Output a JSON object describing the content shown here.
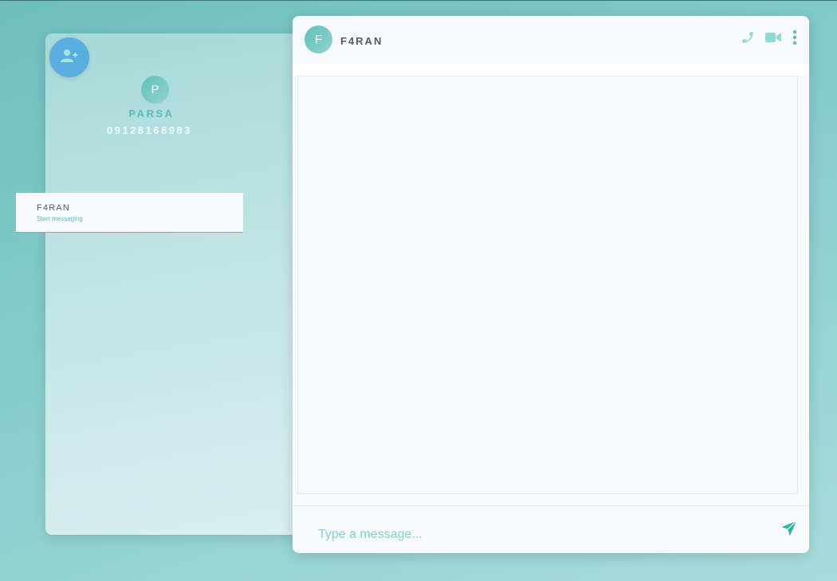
{
  "profile": {
    "avatar_initial": "P",
    "name": "PARSA",
    "phone": "09128168983"
  },
  "contacts": [
    {
      "name": "F4RAN",
      "subtitle": "Start messaging"
    }
  ],
  "chat": {
    "avatar_initial": "F",
    "title": "F4RAN",
    "input_placeholder": "Type a message..."
  },
  "icons": {
    "add_contact": "add-user-icon",
    "call": "phone-icon",
    "video": "video-camera-icon",
    "menu": "more-vertical-icon",
    "send": "send-icon"
  },
  "colors": {
    "accent": "#5cbdb5",
    "add_button": "#58aee0",
    "panel_bg": "#f7f9fd",
    "header_icons": "#8ed9d3",
    "send_icon": "#2ab5ab"
  }
}
